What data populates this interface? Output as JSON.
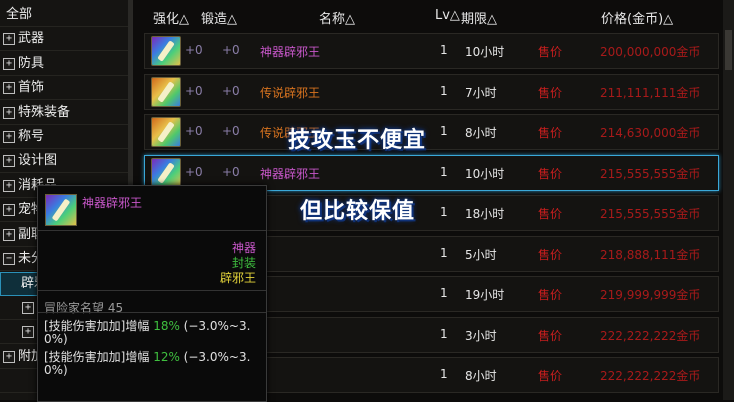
{
  "tree": {
    "items": [
      {
        "label": "全部",
        "expander": ""
      },
      {
        "label": "武器",
        "expander": "+"
      },
      {
        "label": "防具",
        "expander": "+"
      },
      {
        "label": "首饰",
        "expander": "+"
      },
      {
        "label": "特殊装备",
        "expander": "+"
      },
      {
        "label": "称号",
        "expander": "+"
      },
      {
        "label": "设计图",
        "expander": "+"
      },
      {
        "label": "消耗品",
        "expander": "+"
      },
      {
        "label": "宠物",
        "expander": "+"
      },
      {
        "label": "副职业",
        "expander": "+"
      },
      {
        "label": "未分类",
        "expander": "−"
      },
      {
        "label": "辟邪玉",
        "expander": ""
      },
      {
        "label": "",
        "expander": "+"
      },
      {
        "label": "",
        "expander": "+"
      },
      {
        "label": "附加",
        "expander": "+"
      },
      {
        "label": "",
        "expander": ""
      }
    ]
  },
  "header": {
    "enhance": "强化△",
    "forge": "锻造△",
    "name": "名称△",
    "lv": "Lv△",
    "period": "期限△",
    "price": "价格(金币)△"
  },
  "rows": [
    {
      "enhance": "+0",
      "forge": "+0",
      "name": "神器辟邪王",
      "grade": "epic",
      "lv": "1",
      "period": "10小时",
      "sell": "售价",
      "price": "200,000,000金币"
    },
    {
      "enhance": "+0",
      "forge": "+0",
      "name": "传说辟邪王",
      "grade": "legendary",
      "lv": "1",
      "period": "7小时",
      "sell": "售价",
      "price": "211,111,111金币"
    },
    {
      "enhance": "+0",
      "forge": "+0",
      "name": "传说辟邪王",
      "grade": "legendary",
      "lv": "1",
      "period": "8小时",
      "sell": "售价",
      "price": "214,630,000金币"
    },
    {
      "enhance": "+0",
      "forge": "+0",
      "name": "神器辟邪王",
      "grade": "epic",
      "lv": "1",
      "period": "10小时",
      "sell": "售价",
      "price": "215,555,555金币"
    },
    {
      "enhance": "",
      "forge": "",
      "name": "",
      "grade": "epic",
      "lv": "1",
      "period": "18小时",
      "sell": "售价",
      "price": "215,555,555金币"
    },
    {
      "enhance": "",
      "forge": "",
      "name": "",
      "grade": "epic",
      "lv": "1",
      "period": "5小时",
      "sell": "售价",
      "price": "218,888,111金币"
    },
    {
      "enhance": "",
      "forge": "",
      "name": "",
      "grade": "epic",
      "lv": "1",
      "period": "19小时",
      "sell": "售价",
      "price": "219,999,999金币"
    },
    {
      "enhance": "",
      "forge": "",
      "name": "",
      "grade": "epic",
      "lv": "1",
      "period": "3小时",
      "sell": "售价",
      "price": "222,222,222金币"
    },
    {
      "enhance": "",
      "forge": "",
      "name": "",
      "grade": "epic",
      "lv": "1",
      "period": "8小时",
      "sell": "售价",
      "price": "222,222,222金币"
    }
  ],
  "captions": {
    "top": "技攻玉不便宜",
    "bottom": "但比较保值"
  },
  "tooltip": {
    "name": "神器辟邪王",
    "grade": "神器",
    "bind": "封装",
    "type": "辟邪王",
    "fame": "冒险家名望 45",
    "line1_prefix": "[技能伤害加加]增幅 ",
    "line1_value": "18%",
    "line1_range": " (−3.0%~3.",
    "line1_wrap": "0%)",
    "line2_prefix": "[技能伤害加加]增幅 ",
    "line2_value": "12%",
    "line2_range": " (−3.0%~3.",
    "line2_wrap": "0%)"
  }
}
